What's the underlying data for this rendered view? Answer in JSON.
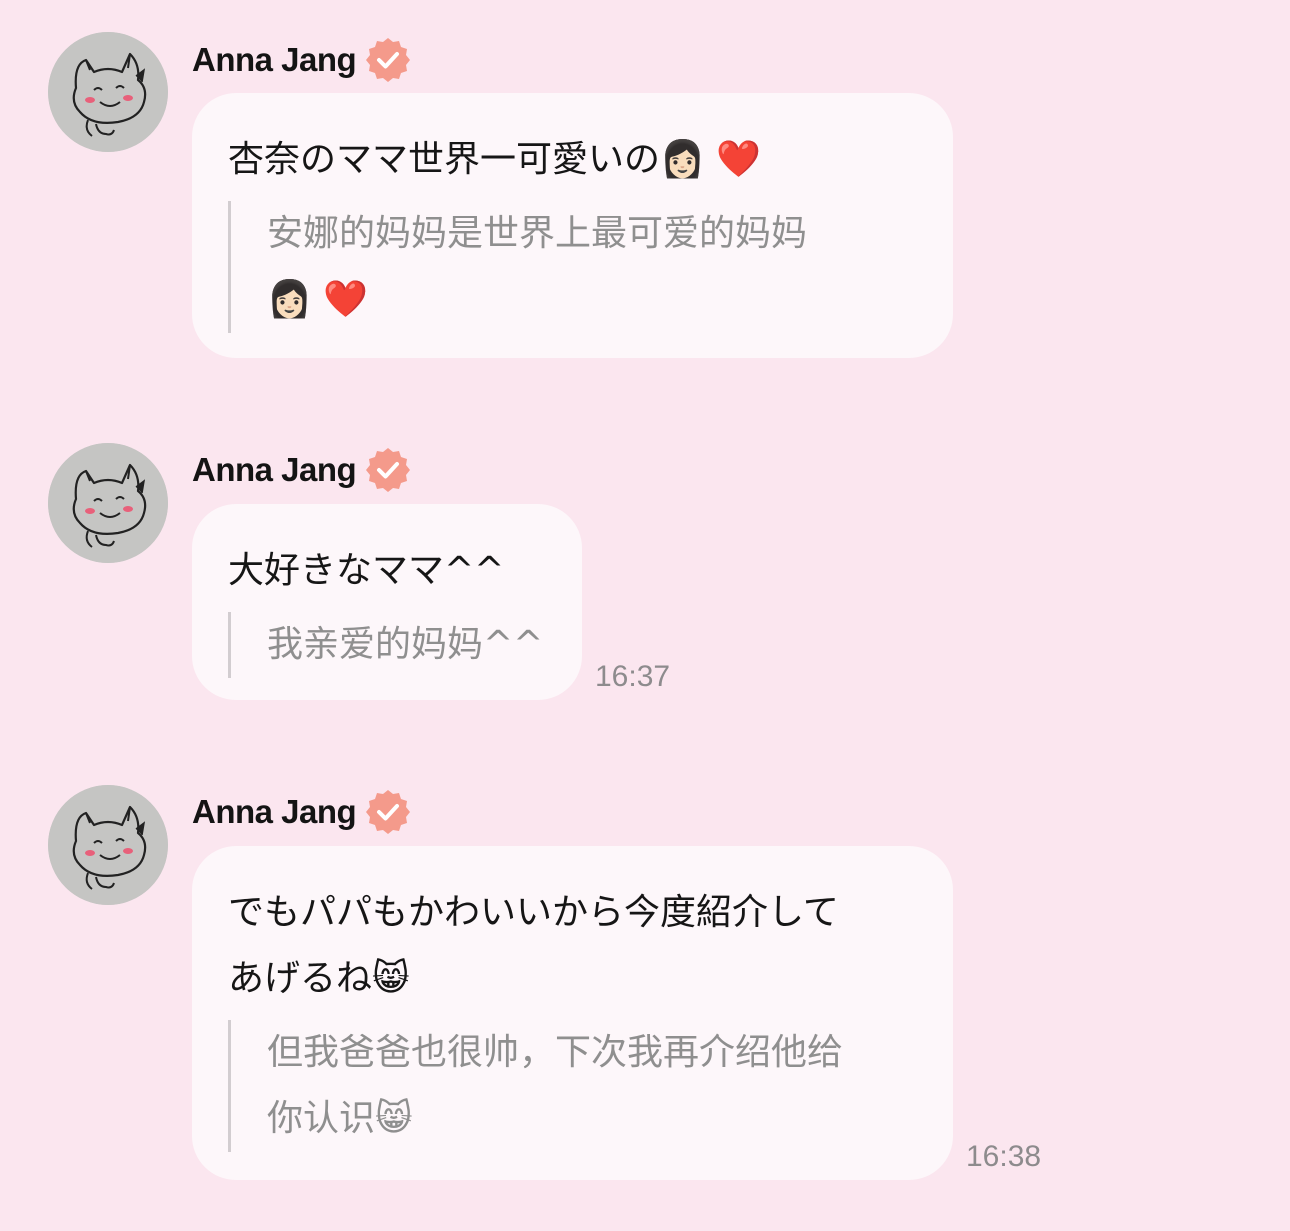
{
  "colors": {
    "background": "#fbe6ef",
    "bubble": "#fdf7fa",
    "verified_badge": "#f49a8b",
    "translation_text": "#8f8f8f"
  },
  "messages": [
    {
      "sender": "Anna Jang",
      "verified": true,
      "avatar_icon": "cat-doodle-icon",
      "original": "杏奈のママ世界一可愛いの👩🏻 ❤️",
      "translation": "安娜的妈妈是世界上最可爱的妈妈\n👩🏻 ❤️",
      "time": ""
    },
    {
      "sender": "Anna Jang",
      "verified": true,
      "avatar_icon": "cat-doodle-icon",
      "original": "大好きなママ^^",
      "translation": "我亲爱的妈妈^^",
      "time": "16:37"
    },
    {
      "sender": "Anna Jang",
      "verified": true,
      "avatar_icon": "cat-doodle-icon",
      "original": "でもパパもかわいいから今度紹介して\nあげるね😸",
      "translation": "但我爸爸也很帅，下次我再介绍他给\n你认识😸",
      "time": "16:38"
    }
  ]
}
